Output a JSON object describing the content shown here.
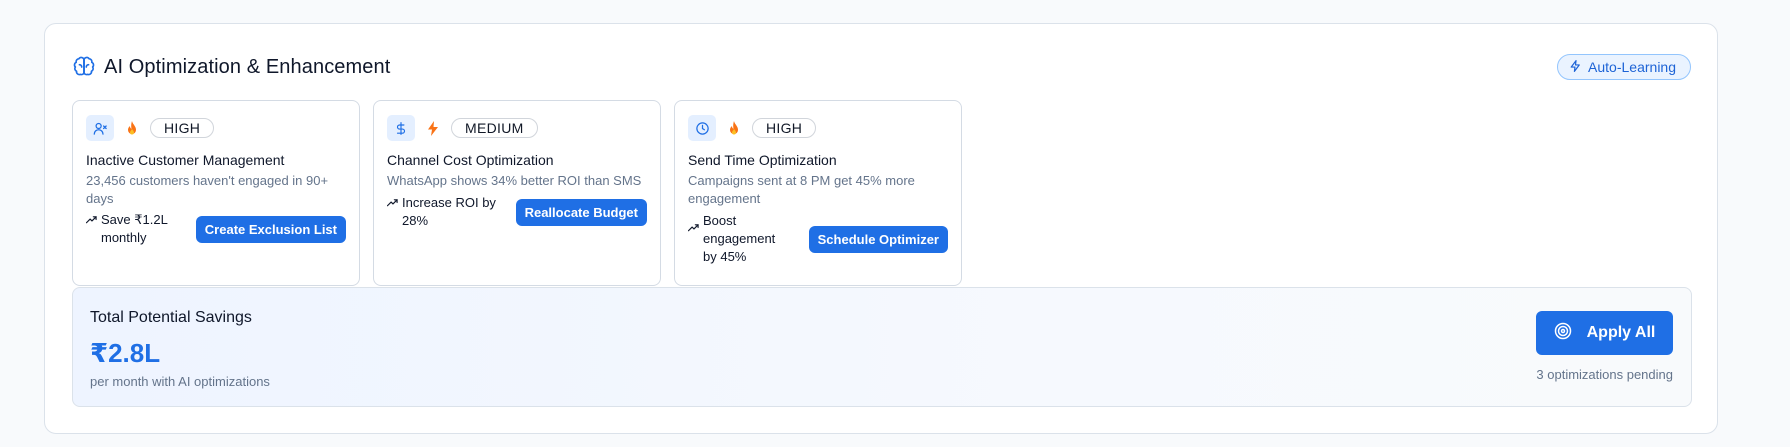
{
  "header": {
    "title": "AI Optimization & Enhancement",
    "title_icon": "brain-icon",
    "badge_label": "Auto-Learning",
    "badge_icon": "lightning-icon"
  },
  "cards": [
    {
      "icon": "user-x-icon",
      "priority_icon": "fire-icon",
      "priority": "HIGH",
      "title": "Inactive Customer Management",
      "description": "23,456 customers haven't engaged in 90+ days",
      "impact": "Save ₹1.2L monthly",
      "action": "Create Exclusion List"
    },
    {
      "icon": "dollar-icon",
      "priority_icon": "bolt-icon",
      "priority": "MEDIUM",
      "title": "Channel Cost Optimization",
      "description": "WhatsApp shows 34% better ROI than SMS",
      "impact": "Increase ROI by 28%",
      "action": "Reallocate Budget"
    },
    {
      "icon": "clock-icon",
      "priority_icon": "fire-icon",
      "priority": "HIGH",
      "title": "Send Time Optimization",
      "description": "Campaigns sent at 8 PM get 45% more engagement",
      "impact": "Boost engagement by 45%",
      "action": "Schedule Optimizer"
    }
  ],
  "savings": {
    "label": "Total Potential Savings",
    "amount": "₹2.8L",
    "subtitle": "per month with AI optimizations",
    "apply_label": "Apply All",
    "apply_icon": "target-icon",
    "pending": "3 optimizations pending"
  },
  "colors": {
    "accent": "#1f6fe5",
    "badge_bg": "#eaf3ff",
    "icon_bg": "#e4efff",
    "muted_text": "#64748b"
  }
}
